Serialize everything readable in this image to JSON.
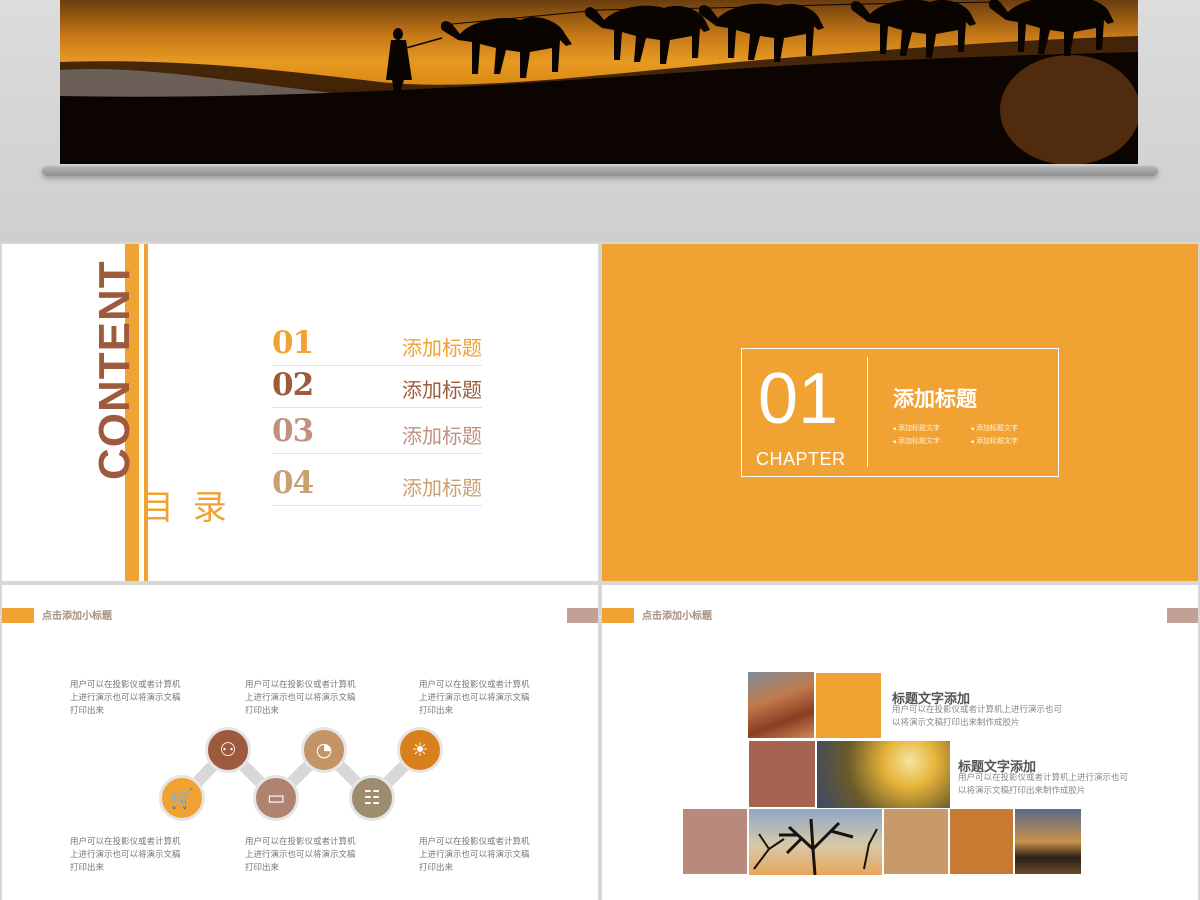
{
  "contents_slide": {
    "word": "CONTENT",
    "sub": "目 录",
    "items": [
      {
        "num": "01",
        "title": "添加标题",
        "num_color": "#f0a232",
        "title_color": "#f0a232"
      },
      {
        "num": "02",
        "title": "添加标题",
        "num_color": "#9e5a3c",
        "title_color": "#9e5a3c"
      },
      {
        "num": "03",
        "title": "添加标题",
        "num_color": "#c09080",
        "title_color": "#c09080"
      },
      {
        "num": "04",
        "title": "添加标题",
        "num_color": "#c9a070",
        "title_color": "#c9a070"
      }
    ]
  },
  "chapter_slide": {
    "number": "01",
    "label": "CHAPTER",
    "title": "添加标题",
    "items": [
      "添加标题文字",
      "添加标题文字",
      "添加标题文字",
      "添加标题文字"
    ]
  },
  "process_slide": {
    "subtitle": "点击添加小标题",
    "desc_text": "用户可以在投影仪或者计算机上进行演示也可以将演示文稿打印出来",
    "steps": [
      {
        "icon": "cart-icon",
        "color": "#f0a232"
      },
      {
        "icon": "people-icon",
        "color": "#9e5a3c"
      },
      {
        "icon": "monitor-icon",
        "color": "#b08270"
      },
      {
        "icon": "pie-chart-icon",
        "color": "#c49467"
      },
      {
        "icon": "bar-chart-icon",
        "color": "#9e8c6e"
      },
      {
        "icon": "lightbulb-icon",
        "color": "#d8801c"
      }
    ]
  },
  "gallery_slide": {
    "subtitle": "点击添加小标题",
    "blocks": [
      {
        "title": "标题文字添加",
        "text": "用户可以在投影仪或者计算机上进行演示也可以将演示文稿打印出来制作成胶片"
      },
      {
        "title": "标题文字添加",
        "text": "用户可以在投影仪或者计算机上进行演示也可以将演示文稿打印出来制作成胶片"
      }
    ],
    "colors": {
      "orange": "#f0a232",
      "brown": "#a5644f",
      "rose": "#b98a7c",
      "tan": "#c89a6a",
      "rust": "#c87a32"
    }
  }
}
